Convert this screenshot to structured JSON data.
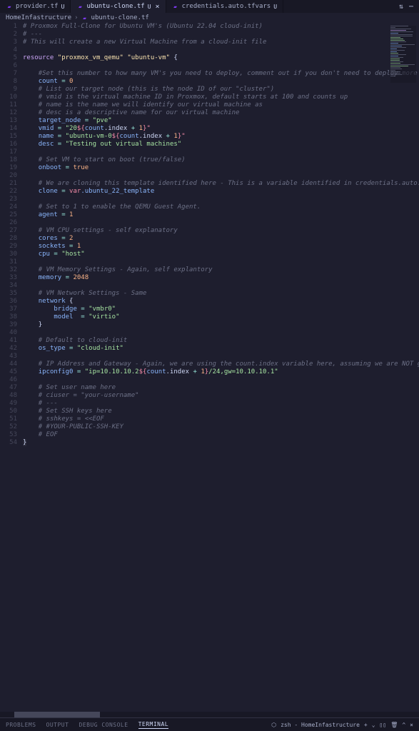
{
  "tabs": [
    {
      "label": "provider.tf",
      "modified": "U"
    },
    {
      "label": "ubuntu-clone.tf",
      "modified": "U"
    },
    {
      "label": "credentials.auto.tfvars",
      "modified": "U"
    }
  ],
  "breadcrumb": {
    "folder": "HomeInfastructure",
    "file": "ubuntu-clone.tf"
  },
  "code": {
    "l1": "# Proxmox Full-Clone for Ubuntu VM's (Ubuntu 22.04 cloud-init)",
    "l2": "# ---",
    "l3": "# This will create a new Virtual Machine from a cloud-init file",
    "l5_kw": "resource",
    "l5_s1": "\"proxmox_vm_qemu\"",
    "l5_s2": "\"ubuntu-vm\"",
    "l7": "#Set this number to how many VM's you need to deploy, comment out if you don't need to deploy more than",
    "l8_prop": "count",
    "l8_val": "0",
    "l9": "# List our target node (this is the node ID of our \"cluster\")",
    "l10": "# vmid is the virtual machine ID in Proxmox, default starts at 100 and counts up",
    "l11": "# name is the name we will identify our virtual machine as",
    "l12": "# desc is a descriptive name for our virtual machine",
    "l13_prop": "target_node",
    "l13_val": "\"pve\"",
    "l14_prop": "vmid",
    "l14_s1": "\"20",
    "l14_interp": "${",
    "l14_count": "count",
    "l14_idx": ".index",
    "l14_plus": " + ",
    "l14_one": "1",
    "l14_close": "}\"",
    "l15_prop": "name",
    "l15_s1": "\"ubuntu-vm-0",
    "l16_prop": "desc",
    "l16_val": "\"Testing out virtual machines\"",
    "l18": "# Set VM to start on boot (true/false)",
    "l19_prop": "onboot",
    "l19_val": "true",
    "l21": "# We are cloning this template identified here - This is a variable identified in credentials.auto.tfvar",
    "l22_prop": "clone",
    "l22_var": "var",
    "l22_attr": ".ubuntu_22_template",
    "l24": "# Set to 1 to enable the QEMU Guest Agent.",
    "l25_prop": "agent",
    "l25_val": "1",
    "l27": "# VM CPU settings - self explanatory",
    "l28_prop": "cores",
    "l28_val": "2",
    "l29_prop": "sockets",
    "l29_val": "1",
    "l30_prop": "cpu",
    "l30_val": "\"host\"",
    "l32": "# VM Memory Settings - Again, self explantory",
    "l33_prop": "memory",
    "l33_val": "2048",
    "l35": "# VM Network Settings - Same",
    "l36_prop": "network",
    "l37_prop": "bridge",
    "l37_val": "\"vmbr0\"",
    "l38_prop": "model",
    "l38_val": "\"virtio\"",
    "l41": "# Default to cloud-init",
    "l42_prop": "os_type",
    "l42_val": "\"cloud-init\"",
    "l44": "# IP Address and Gateway - Again, we are using the count.index variable here, assuming we are NOT going ",
    "l45_prop": "ipconfig0",
    "l45_s1": "\"ip=10.10.10.2",
    "l45_s2": "/24,gw=10.10.10.1\"",
    "l47": "# Set user name here",
    "l48": "# ciuser = \"your-username\"",
    "l49": "# ---",
    "l50": "# Set SSH keys here",
    "l51": "# sshkeys = <<EOF",
    "l52": "# #YOUR-PUBLIC-SSH-KEY",
    "l53": "# EOF"
  },
  "panel": {
    "problems": "PROBLEMS",
    "output": "OUTPUT",
    "debug": "DEBUG CONSOLE",
    "terminal": "TERMINAL",
    "shell": "zsh - HomeInfastructure"
  }
}
